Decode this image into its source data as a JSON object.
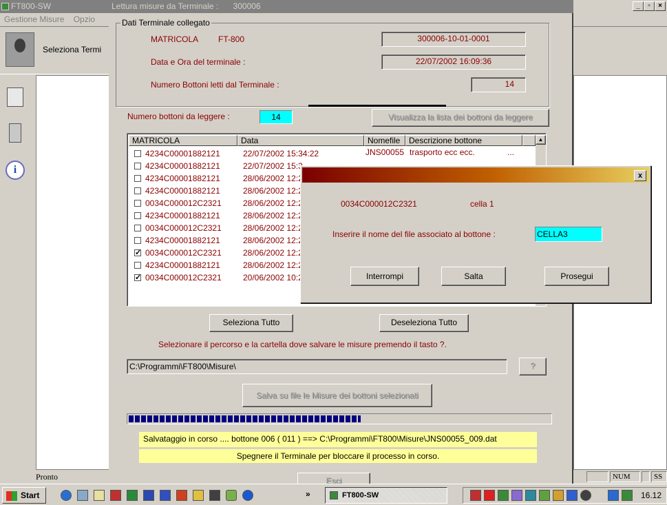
{
  "app": {
    "title": "FT800-SW",
    "menu": [
      "Gestione Misure",
      "Opzio"
    ],
    "toolbar_label": "Seleziona Termi",
    "status_text": "Pronto",
    "status_panels": [
      "NUM",
      "SS"
    ]
  },
  "dialog": {
    "title": "Lettura misure da Terminale",
    "title_number": "300006",
    "group_label": "Dati Terminale collegato",
    "matricola_label": "MATRICOLA",
    "matricola_model": "FT-800",
    "matricola_value": "300006-10-01-0001",
    "datetime_label": "Data e Ora del terminale :",
    "datetime_value": "22/07/2002  16:09:36",
    "buttons_read_label": "Numero Bottoni letti dal Terminale :",
    "buttons_read_value": "14",
    "to_read_label": "Numero bottoni da leggere :",
    "to_read_value": "14",
    "show_list_button": "Visualizza la lista dei bottoni da leggere",
    "list": {
      "headers": [
        "MATRICOLA",
        "Data",
        "Nomefile",
        "Descrizione bottone"
      ],
      "rows": [
        {
          "checked": false,
          "matricola": "4234C00001882121",
          "data": "22/07/2002 15:34:22",
          "nomefile": "JNS00055",
          "descrizione": "trasporto ecc ecc.",
          "extra": "..."
        },
        {
          "checked": false,
          "matricola": "4234C00001882121",
          "data": "22/07/2002 15:3"
        },
        {
          "checked": false,
          "matricola": "4234C00001882121",
          "data": "28/06/2002 12:2"
        },
        {
          "checked": false,
          "matricola": "4234C00001882121",
          "data": "28/06/2002 12:2"
        },
        {
          "checked": false,
          "matricola": "0034C000012C2321",
          "data": "28/06/2002 12:2"
        },
        {
          "checked": false,
          "matricola": "4234C00001882121",
          "data": "28/06/2002 12:2"
        },
        {
          "checked": false,
          "matricola": "0034C000012C2321",
          "data": "28/06/2002 12:2"
        },
        {
          "checked": false,
          "matricola": "4234C00001882121",
          "data": "28/06/2002 12:2"
        },
        {
          "checked": true,
          "matricola": "0034C000012C2321",
          "data": "28/06/2002 12:2"
        },
        {
          "checked": false,
          "matricola": "4234C00001882121",
          "data": "28/06/2002 12:2"
        },
        {
          "checked": true,
          "matricola": "0034C000012C2321",
          "data": "20/06/2002 10:2"
        }
      ]
    },
    "select_all_button": "Seleziona Tutto",
    "deselect_all_button": "Deseleziona Tutto",
    "path_instruction": "Selezionare il percorso e la cartella dove salvare le misure premendo il tasto ?.",
    "path_value": "C:\\Programmi\\FT800\\Misure\\",
    "browse_button": "?",
    "save_button": "Salva su file le Misure dei bottoni selezionati",
    "progress_fraction": 0.55,
    "saving_status": "Salvataggio in corso .... bottone   006 ( 011 ) ==> C:\\Programmi\\FT800\\Misure\\JNS00055_009.dat",
    "warning": "Spegnere il Terminale per bloccare il processo in corso.",
    "exit_button": "Esci"
  },
  "popup": {
    "close": "x",
    "button_id": "0034C000012C2321",
    "cell": "cella 1",
    "prompt": "Inserire il nome del file associato al bottone :",
    "file_value": "CELLA3",
    "interrompi": "Interrompi",
    "salta": "Salta",
    "prosegui": "Prosegui"
  },
  "taskbar": {
    "start": "Start",
    "more": "»",
    "task_item": "FT800-SW",
    "clock": "16.12"
  },
  "colors": {
    "window_bg": "#d4d0c8",
    "dark_red_text": "#8b0000",
    "highlight_cyan": "#00ffff",
    "progress": "#000080",
    "status_yellow": "#ffff99"
  }
}
